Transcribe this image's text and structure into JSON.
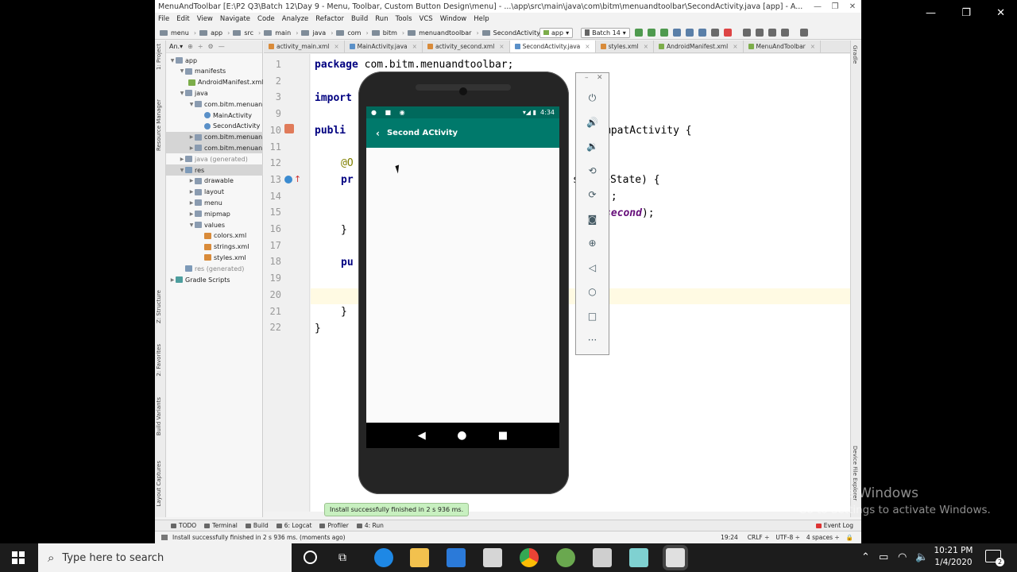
{
  "window": {
    "title": "MenuAndToolbar [E:\\P2 Q3\\Batch 12\\Day 9 - Menu, Toolbar, Custom Button Design\\menu] - ...\\app\\src\\main\\java\\com\\bitm\\menuandtoolbar\\SecondActivity.java [app] - A...",
    "outer_controls": [
      "—",
      "❐",
      "✕"
    ]
  },
  "menu": [
    "File",
    "Edit",
    "View",
    "Navigate",
    "Code",
    "Analyze",
    "Refactor",
    "Build",
    "Run",
    "Tools",
    "VCS",
    "Window",
    "Help"
  ],
  "breadcrumbs": [
    "menu",
    "app",
    "src",
    "main",
    "java",
    "com",
    "bitm",
    "menuandtoolbar",
    "SecondActivity"
  ],
  "toolbar": {
    "config": "app",
    "device": "Batch 14"
  },
  "project_panel": {
    "header": "An.▾"
  },
  "tree": [
    {
      "label": "app",
      "indent": 0,
      "arrow": "▼",
      "icon": "folder"
    },
    {
      "label": "manifests",
      "indent": 1,
      "arrow": "▼",
      "icon": "folder"
    },
    {
      "label": "AndroidManifest.xml",
      "indent": 2,
      "arrow": "",
      "icon": "man"
    },
    {
      "label": "java",
      "indent": 1,
      "arrow": "▼",
      "icon": "folder"
    },
    {
      "label": "com.bitm.menuan",
      "indent": 2,
      "arrow": "▼",
      "icon": "folder"
    },
    {
      "label": "MainActivity",
      "indent": 3,
      "arrow": "",
      "icon": "java"
    },
    {
      "label": "SecondActivity",
      "indent": 3,
      "arrow": "",
      "icon": "java"
    },
    {
      "label": "com.bitm.menuan",
      "indent": 2,
      "arrow": "▶",
      "icon": "folder",
      "sel": true
    },
    {
      "label": "com.bitm.menuan",
      "indent": 2,
      "arrow": "▶",
      "icon": "folder",
      "sel": true
    },
    {
      "label": "java (generated)",
      "indent": 1,
      "arrow": "▶",
      "icon": "folder",
      "muted": true
    },
    {
      "label": "res",
      "indent": 1,
      "arrow": "▼",
      "icon": "res",
      "sel": true
    },
    {
      "label": "drawable",
      "indent": 2,
      "arrow": "▶",
      "icon": "folder"
    },
    {
      "label": "layout",
      "indent": 2,
      "arrow": "▶",
      "icon": "folder"
    },
    {
      "label": "menu",
      "indent": 2,
      "arrow": "▶",
      "icon": "folder"
    },
    {
      "label": "mipmap",
      "indent": 2,
      "arrow": "▶",
      "icon": "folder"
    },
    {
      "label": "values",
      "indent": 2,
      "arrow": "▼",
      "icon": "folder"
    },
    {
      "label": "colors.xml",
      "indent": 3,
      "arrow": "",
      "icon": "xml"
    },
    {
      "label": "strings.xml",
      "indent": 3,
      "arrow": "",
      "icon": "xml"
    },
    {
      "label": "styles.xml",
      "indent": 3,
      "arrow": "",
      "icon": "xml"
    },
    {
      "label": "res (generated)",
      "indent": 1,
      "arrow": "",
      "icon": "res",
      "muted": true
    },
    {
      "label": "Gradle Scripts",
      "indent": 0,
      "arrow": "▶",
      "icon": "grad"
    }
  ],
  "left_tabs": [
    "1: Project",
    "Resource Manager",
    "Z: Structure",
    "2: Favorites",
    "Build Variants",
    "Layout Captures"
  ],
  "right_tabs": [
    "Gradle",
    "Device File Explorer"
  ],
  "editor_tabs": [
    {
      "label": "activity_main.xml",
      "icon": "#d98b3a"
    },
    {
      "label": "MainActivity.java",
      "icon": "#5a90c8"
    },
    {
      "label": "activity_second.xml",
      "icon": "#d98b3a"
    },
    {
      "label": "SecondActivity.java",
      "icon": "#5a90c8",
      "active": true
    },
    {
      "label": "styles.xml",
      "icon": "#d98b3a"
    },
    {
      "label": "AndroidManifest.xml",
      "icon": "#7cad4a"
    },
    {
      "label": "MenuAndToolbar",
      "icon": "#7cad4a"
    }
  ],
  "line_numbers": [
    "1",
    "2",
    "3",
    "9",
    "10",
    "11",
    "12",
    "13",
    "14",
    "15",
    "16",
    "17",
    "18",
    "19",
    "20",
    "21",
    "22"
  ],
  "code_fragments": {
    "package_kw": "package",
    "package_name": " com.bitm.menuandtoolbar;",
    "import_kw": "import",
    "public_kw": "publi",
    "class_tail": "mpatActivity {",
    "at": "@O",
    "pr": "pr",
    "instance": "stanceState) {",
    "paren": ");",
    "second": "second",
    "second_tail": ");",
    "brace15": "}",
    "pu": "pu",
    "brace20": "}",
    "brace21": "}",
    "s13": "s",
    "i14": "t"
  },
  "bottom_tabs": [
    "TODO",
    "Terminal",
    "Build",
    "6: Logcat",
    "Profiler",
    "4: Run",
    "Event Log"
  ],
  "status": {
    "message": "Install successfully finished in 2 s 936 ms. (moments ago)",
    "position": "19:24",
    "line_sep": "CRLF ÷",
    "encoding": "UTF-8 ÷",
    "indent": "4 spaces ÷"
  },
  "toast": "Install successfully finished in 2 s 936 ms.",
  "phone": {
    "time": "4:34",
    "app_title": "Second ACtivity"
  },
  "emulator_controls": [
    "power",
    "volume-up",
    "volume-down",
    "rotate-left",
    "rotate-right",
    "camera",
    "zoom",
    "back",
    "home",
    "overview",
    "more"
  ],
  "windows": {
    "search_placeholder": "Type here to search",
    "time": "10:21 PM",
    "date": "1/4/2020",
    "notif": "2",
    "activate_title": "Activate Windows",
    "activate_sub": "Go to Settings to activate Windows."
  }
}
